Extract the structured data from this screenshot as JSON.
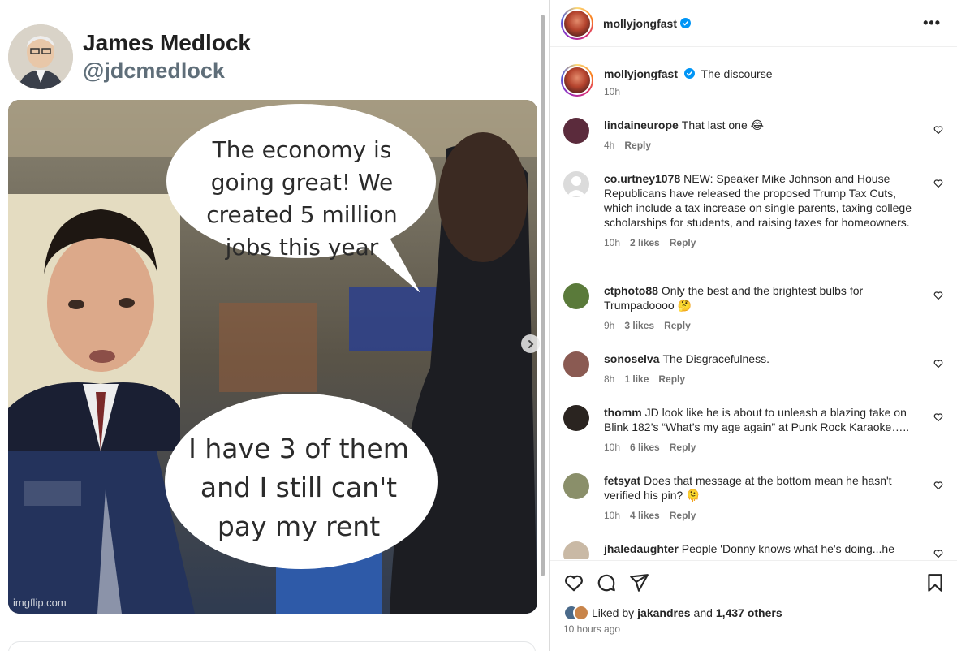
{
  "media": {
    "author_name": "James Medlock",
    "author_handle": "@jdcmedlock",
    "bubble_top": "The economy is going great! We created 5 million jobs this year",
    "bubble_bottom": "I have 3 of them and I still can't pay my rent",
    "watermark": "imgflip.com",
    "next_icon": "chevron-right-icon"
  },
  "header": {
    "username": "mollyjongfast",
    "verified_icon": "verified-badge-icon",
    "more_icon": "more-horizontal-icon",
    "more_label": "•••"
  },
  "caption": {
    "username": "mollyjongfast",
    "text": "The discourse",
    "time": "10h"
  },
  "comments": [
    {
      "username": "lindaineurope",
      "text": "That last one 😂",
      "time": "4h",
      "likes": "",
      "reply": "Reply",
      "avatar_color": "#5b2b3c"
    },
    {
      "username": "co.urtney1078",
      "text": "NEW: Speaker Mike Johnson and House Republicans have released the proposed Trump Tax Cuts, which include a tax increase on single parents, taxing college scholarships for students, and raising taxes for homeowners.",
      "time": "10h",
      "likes": "2 likes",
      "reply": "Reply",
      "avatar_color": "#dbdbdb"
    },
    {
      "username": "ctphoto88",
      "text": "Only the best and the brightest bulbs for Trumpadoooo 🤔",
      "time": "9h",
      "likes": "3 likes",
      "reply": "Reply",
      "avatar_color": "#5a7a3a"
    },
    {
      "username": "sonoselva",
      "text": "The Disgracefulness.",
      "time": "8h",
      "likes": "1 like",
      "reply": "Reply",
      "avatar_color": "#8a5a52"
    },
    {
      "username": "thomm",
      "text": "JD look like he is about to unleash a blazing take on Blink 182’s “What’s my age again” at Punk Rock Karaoke…..",
      "time": "10h",
      "likes": "6 likes",
      "reply": "Reply",
      "avatar_color": "#2a2420"
    },
    {
      "username": "fetsyat",
      "text": "Does that message at the bottom mean he hasn't verified his pin? 🫠",
      "time": "10h",
      "likes": "4 likes",
      "reply": "Reply",
      "avatar_color": "#8a8f6a"
    },
    {
      "username": "jhaledaughter",
      "text": "People 'Donny knows what he's doing...he",
      "time": "",
      "likes": "",
      "reply": "",
      "avatar_color": "#c9b9a5"
    }
  ],
  "actions": {
    "like_icon": "heart-icon",
    "comment_icon": "comment-icon",
    "share_icon": "send-icon",
    "save_icon": "bookmark-icon",
    "liked_by_prefix": "Liked by",
    "liked_by_user": "jakandres",
    "liked_by_and": "and",
    "liked_by_others": "1,437 others",
    "timestamp": "10 hours ago"
  },
  "colors": {
    "verified": "#0095f6",
    "meta_text": "#737373",
    "text": "#262626"
  }
}
